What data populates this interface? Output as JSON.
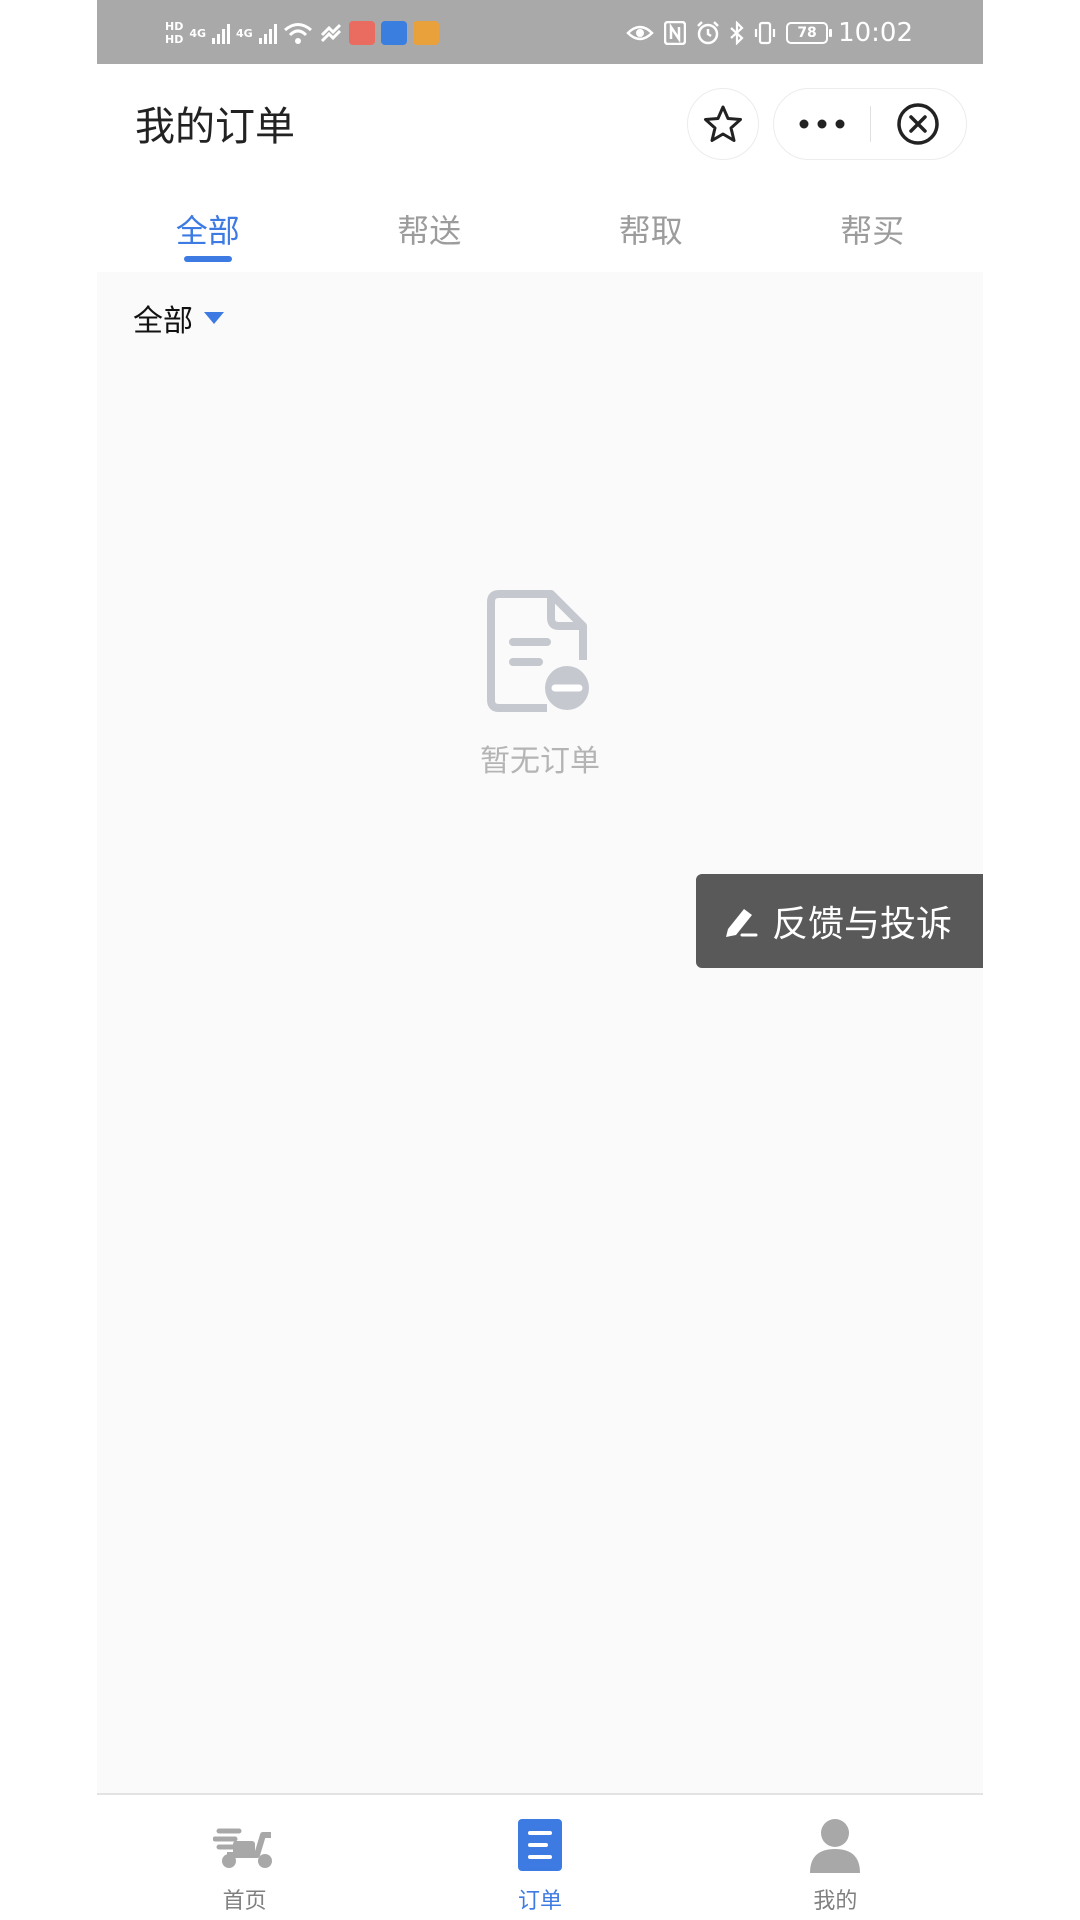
{
  "status_bar": {
    "time": "10:02",
    "battery": "78",
    "net_a": "4G",
    "net_b": "4G",
    "hd": "HD"
  },
  "header": {
    "title": "我的订单"
  },
  "tabs": [
    {
      "label": "全部",
      "active": true
    },
    {
      "label": "帮送",
      "active": false
    },
    {
      "label": "帮取",
      "active": false
    },
    {
      "label": "帮买",
      "active": false
    }
  ],
  "filter": {
    "label": "全部"
  },
  "empty_state": {
    "text": "暂无订单"
  },
  "feedback": {
    "label": "反馈与投诉"
  },
  "bottom_nav": [
    {
      "label": "首页",
      "icon": "scooter-icon",
      "active": false
    },
    {
      "label": "订单",
      "icon": "order-doc-icon",
      "active": true
    },
    {
      "label": "我的",
      "icon": "user-icon",
      "active": false
    }
  ],
  "colors": {
    "accent": "#3d7be3",
    "inactive_text": "#9c9c9c",
    "status_bar_bg": "#a9a9a9",
    "feedback_bg": "#595959"
  }
}
